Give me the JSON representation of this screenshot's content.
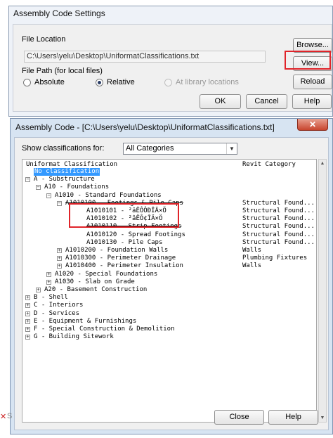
{
  "settings_dialog": {
    "title": "Assembly Code Settings",
    "file_location_label": "File Location",
    "file_path": "C:\\Users\\yelu\\Desktop\\UniformatClassifications.txt",
    "file_path_type_label": "File Path (for local files)",
    "radio_absolute": "Absolute",
    "radio_relative": "Relative",
    "radio_library": "At library locations",
    "selected_path_type": "Relative",
    "browse_button": "Browse...",
    "view_button": "View...",
    "reload_button": "Reload",
    "ok_button": "OK",
    "cancel_button": "Cancel",
    "help_button": "Help"
  },
  "assembly_dialog": {
    "title": "Assembly Code - [C:\\Users\\yelu\\Desktop\\UniformatClassifications.txt]",
    "close_glyph": "✕",
    "show_label": "Show classifications for:",
    "filter_value": "All Categories",
    "col_classification": "Uniformat Classification",
    "col_category": "Revit Category",
    "close_button": "Close",
    "help_button": "Help",
    "tree": [
      {
        "text": "No classification",
        "category": "",
        "expander": ""
      },
      {
        "text": "A - Substructure",
        "category": "",
        "expander": "−"
      },
      {
        "text": "A10 - Foundations",
        "category": "",
        "expander": "−"
      },
      {
        "text": "A1010 - Standard Foundations",
        "category": "",
        "expander": "−"
      },
      {
        "text": "A1010100 - Footings & Pile Caps",
        "category": "Structural Found...",
        "expander": "−"
      },
      {
        "text": "A1010101 - ²âÊÔÔÐÎÄ×Ö",
        "category": "Structural Found...",
        "expander": ""
      },
      {
        "text": "A1010102 - ²âÊÔ¢ÎÄ×Ö",
        "category": "Structural Found...",
        "expander": ""
      },
      {
        "text": "A1010110 - Strip Footings",
        "category": "Structural Found...",
        "expander": ""
      },
      {
        "text": "A1010120 - Spread Footings",
        "category": "Structural Found...",
        "expander": ""
      },
      {
        "text": "A1010130 - Pile Caps",
        "category": "Structural Found...",
        "expander": ""
      },
      {
        "text": "A1010200 - Foundation Walls",
        "category": "Walls",
        "expander": "+"
      },
      {
        "text": "A1010300 - Perimeter Drainage",
        "category": "Plumbing Fixtures",
        "expander": "+"
      },
      {
        "text": "A1010400 - Perimeter Insulation",
        "category": "Walls",
        "expander": "+"
      },
      {
        "text": "A1020 - Special Foundations",
        "category": "",
        "expander": "+"
      },
      {
        "text": "A1030 - Slab on Grade",
        "category": "",
        "expander": "+"
      },
      {
        "text": "A20 - Basement Construction",
        "category": "",
        "expander": "+"
      },
      {
        "text": "B - Shell",
        "category": "",
        "expander": "+"
      },
      {
        "text": "C - Interiors",
        "category": "",
        "expander": "+"
      },
      {
        "text": "D - Services",
        "category": "",
        "expander": "+"
      },
      {
        "text": "E - Equipment & Furnishings",
        "category": "",
        "expander": "+"
      },
      {
        "text": "F - Special Construction & Demolition",
        "category": "",
        "expander": "+"
      },
      {
        "text": "G - Building Sitework",
        "category": "",
        "expander": "+"
      }
    ]
  },
  "colors": {
    "highlight": "#e0242a",
    "selection": "#3399ff"
  },
  "background_fragment": {
    "close_mark": "✕",
    "letter": "S"
  }
}
